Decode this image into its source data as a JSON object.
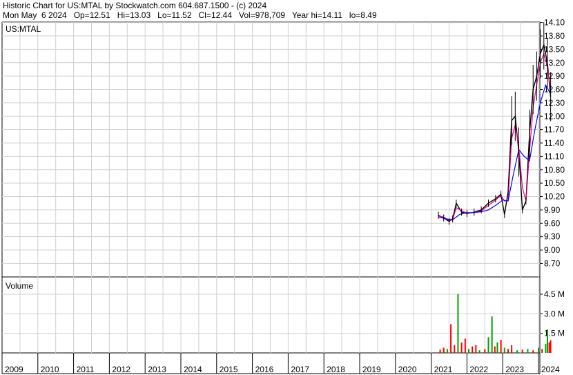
{
  "header": {
    "line1": "Historic Chart for US:MTAL by Stockwatch.com 604.687.1500 - (c) 2024",
    "line2": "Mon May  6 2024   Op=12.51   Hi=13.03   Lo=11.52   Cl=12.44   Vol=978,709   Year hi=14.11   lo=8.49"
  },
  "chart_data": [
    {
      "type": "line",
      "label": "US:MTAL",
      "ylabel_ticks": [
        "14.10",
        "13.80",
        "13.50",
        "13.20",
        "12.90",
        "12.60",
        "12.30",
        "12.00",
        "11.70",
        "11.40",
        "11.10",
        "10.80",
        "10.50",
        "10.20",
        "9.90",
        "9.60",
        "9.30",
        "9.00",
        "8.70"
      ],
      "ylim": [
        8.49,
        14.11
      ],
      "x_labels": [
        "2009",
        "2010",
        "2011",
        "2012",
        "2013",
        "2014",
        "2015",
        "2016",
        "2017",
        "2018",
        "2019",
        "2020",
        "2021",
        "2022",
        "2023",
        "2024"
      ],
      "grid": true,
      "series": [
        {
          "color": "#000000",
          "x": [
            2021.2,
            2021.35,
            2021.5,
            2021.6,
            2021.7,
            2021.85,
            2022.0,
            2022.2,
            2022.4,
            2022.6,
            2022.8,
            2022.95,
            2023.05,
            2023.15,
            2023.25,
            2023.35,
            2023.45,
            2023.55,
            2023.65,
            2023.75,
            2023.85,
            2023.95,
            2024.05,
            2024.15,
            2024.25,
            2024.34
          ],
          "values": [
            9.78,
            9.72,
            9.64,
            9.7,
            10.05,
            9.85,
            9.82,
            9.85,
            9.9,
            10.05,
            10.15,
            10.25,
            9.8,
            10.3,
            11.9,
            12.0,
            11.2,
            9.9,
            10.1,
            11.6,
            12.6,
            12.9,
            13.4,
            13.6,
            13.2,
            12.44
          ]
        },
        {
          "color": "#e0007f",
          "x": [
            2021.2,
            2021.35,
            2021.5,
            2021.6,
            2021.7,
            2021.85,
            2022.0,
            2022.2,
            2022.4,
            2022.6,
            2022.8,
            2022.95,
            2023.05,
            2023.15,
            2023.25,
            2023.35,
            2023.45,
            2023.55,
            2023.65,
            2023.75,
            2023.85,
            2023.95,
            2024.05,
            2024.15,
            2024.25,
            2024.34
          ],
          "values": [
            9.76,
            9.74,
            9.66,
            9.68,
            9.95,
            9.88,
            9.83,
            9.84,
            9.88,
            10.0,
            10.12,
            10.22,
            10.1,
            10.1,
            11.5,
            11.8,
            11.3,
            10.4,
            10.1,
            11.2,
            12.2,
            12.7,
            13.2,
            13.4,
            13.1,
            12.6
          ]
        },
        {
          "color": "#0000ff",
          "x": [
            2021.2,
            2021.4,
            2021.6,
            2021.8,
            2022.0,
            2022.2,
            2022.4,
            2022.6,
            2022.8,
            2023.0,
            2023.15,
            2023.3,
            2023.45,
            2023.6,
            2023.75,
            2023.9,
            2024.05,
            2024.2,
            2024.34
          ],
          "values": [
            9.74,
            9.7,
            9.68,
            9.8,
            9.84,
            9.84,
            9.86,
            9.9,
            10.0,
            10.12,
            10.1,
            10.7,
            11.25,
            11.1,
            11.0,
            11.7,
            12.3,
            12.7,
            12.5
          ]
        }
      ]
    },
    {
      "type": "bar",
      "label": "Volume",
      "ylabel_ticks": [
        "4.5 M",
        "3.0 M",
        "1.5 M"
      ],
      "ylim": [
        0,
        5400000
      ],
      "bars": [
        {
          "x": 2021.25,
          "v": 250000,
          "color": "#ff0000"
        },
        {
          "x": 2021.35,
          "v": 400000,
          "color": "#ff0000"
        },
        {
          "x": 2021.45,
          "v": 300000,
          "color": "#00a000"
        },
        {
          "x": 2021.55,
          "v": 2200000,
          "color": "#ff0000"
        },
        {
          "x": 2021.65,
          "v": 600000,
          "color": "#ff0000"
        },
        {
          "x": 2021.75,
          "v": 4500000,
          "color": "#00a000"
        },
        {
          "x": 2021.85,
          "v": 800000,
          "color": "#ff0000"
        },
        {
          "x": 2021.95,
          "v": 1100000,
          "color": "#ff0000"
        },
        {
          "x": 2022.05,
          "v": 300000,
          "color": "#00a000"
        },
        {
          "x": 2022.15,
          "v": 500000,
          "color": "#ff0000"
        },
        {
          "x": 2022.25,
          "v": 600000,
          "color": "#ff0000"
        },
        {
          "x": 2022.35,
          "v": 200000,
          "color": "#00a000"
        },
        {
          "x": 2022.5,
          "v": 300000,
          "color": "#ff0000"
        },
        {
          "x": 2022.6,
          "v": 1200000,
          "color": "#00a000"
        },
        {
          "x": 2022.7,
          "v": 2800000,
          "color": "#00a000"
        },
        {
          "x": 2022.78,
          "v": 500000,
          "color": "#ff0000"
        },
        {
          "x": 2022.85,
          "v": 800000,
          "color": "#00a000"
        },
        {
          "x": 2022.95,
          "v": 1000000,
          "color": "#ff0000"
        },
        {
          "x": 2023.05,
          "v": 400000,
          "color": "#00a000"
        },
        {
          "x": 2023.15,
          "v": 300000,
          "color": "#ff0000"
        },
        {
          "x": 2023.25,
          "v": 600000,
          "color": "#ff0000"
        },
        {
          "x": 2023.4,
          "v": 200000,
          "color": "#00a000"
        },
        {
          "x": 2023.55,
          "v": 250000,
          "color": "#ff0000"
        },
        {
          "x": 2023.7,
          "v": 300000,
          "color": "#00a000"
        },
        {
          "x": 2023.85,
          "v": 200000,
          "color": "#ff0000"
        },
        {
          "x": 2024.0,
          "v": 400000,
          "color": "#00a000"
        },
        {
          "x": 2024.1,
          "v": 300000,
          "color": "#ff0000"
        },
        {
          "x": 2024.2,
          "v": 700000,
          "color": "#00a000"
        },
        {
          "x": 2024.25,
          "v": 1800000,
          "color": "#00a000"
        },
        {
          "x": 2024.3,
          "v": 800000,
          "color": "#ff0000"
        },
        {
          "x": 2024.34,
          "v": 978709,
          "color": "#ff0000"
        }
      ]
    }
  ]
}
